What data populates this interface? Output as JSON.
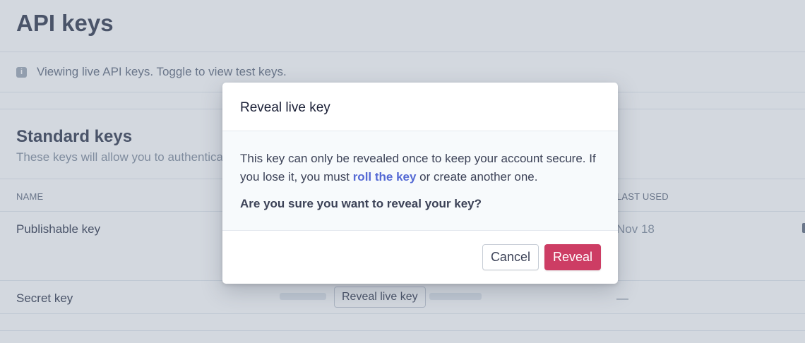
{
  "page": {
    "title": "API keys",
    "banner_text": "Viewing live API keys. Toggle to view test keys.",
    "info_icon_glyph": "i"
  },
  "standard_keys": {
    "title": "Standard keys",
    "subtitle": "These keys will allow you to authentica",
    "columns": {
      "name": "NAME",
      "last_used": "LAST USED"
    },
    "rows": [
      {
        "name": "Publishable key",
        "last_used": "Nov 18"
      },
      {
        "name": "Secret key",
        "reveal_label": "Reveal live key",
        "last_used": "—"
      }
    ]
  },
  "modal": {
    "title": "Reveal live key",
    "body_pre": "This key can only be revealed once to keep your account secure. If you lose it, you must ",
    "body_link": "roll the key",
    "body_post": " or create another one.",
    "question": "Are you sure you want to reveal your key?",
    "cancel_label": "Cancel",
    "reveal_label": "Reveal"
  },
  "colors": {
    "accent": "#5469d4",
    "danger": "#cd3d64",
    "overlay": "#6e7d96"
  }
}
